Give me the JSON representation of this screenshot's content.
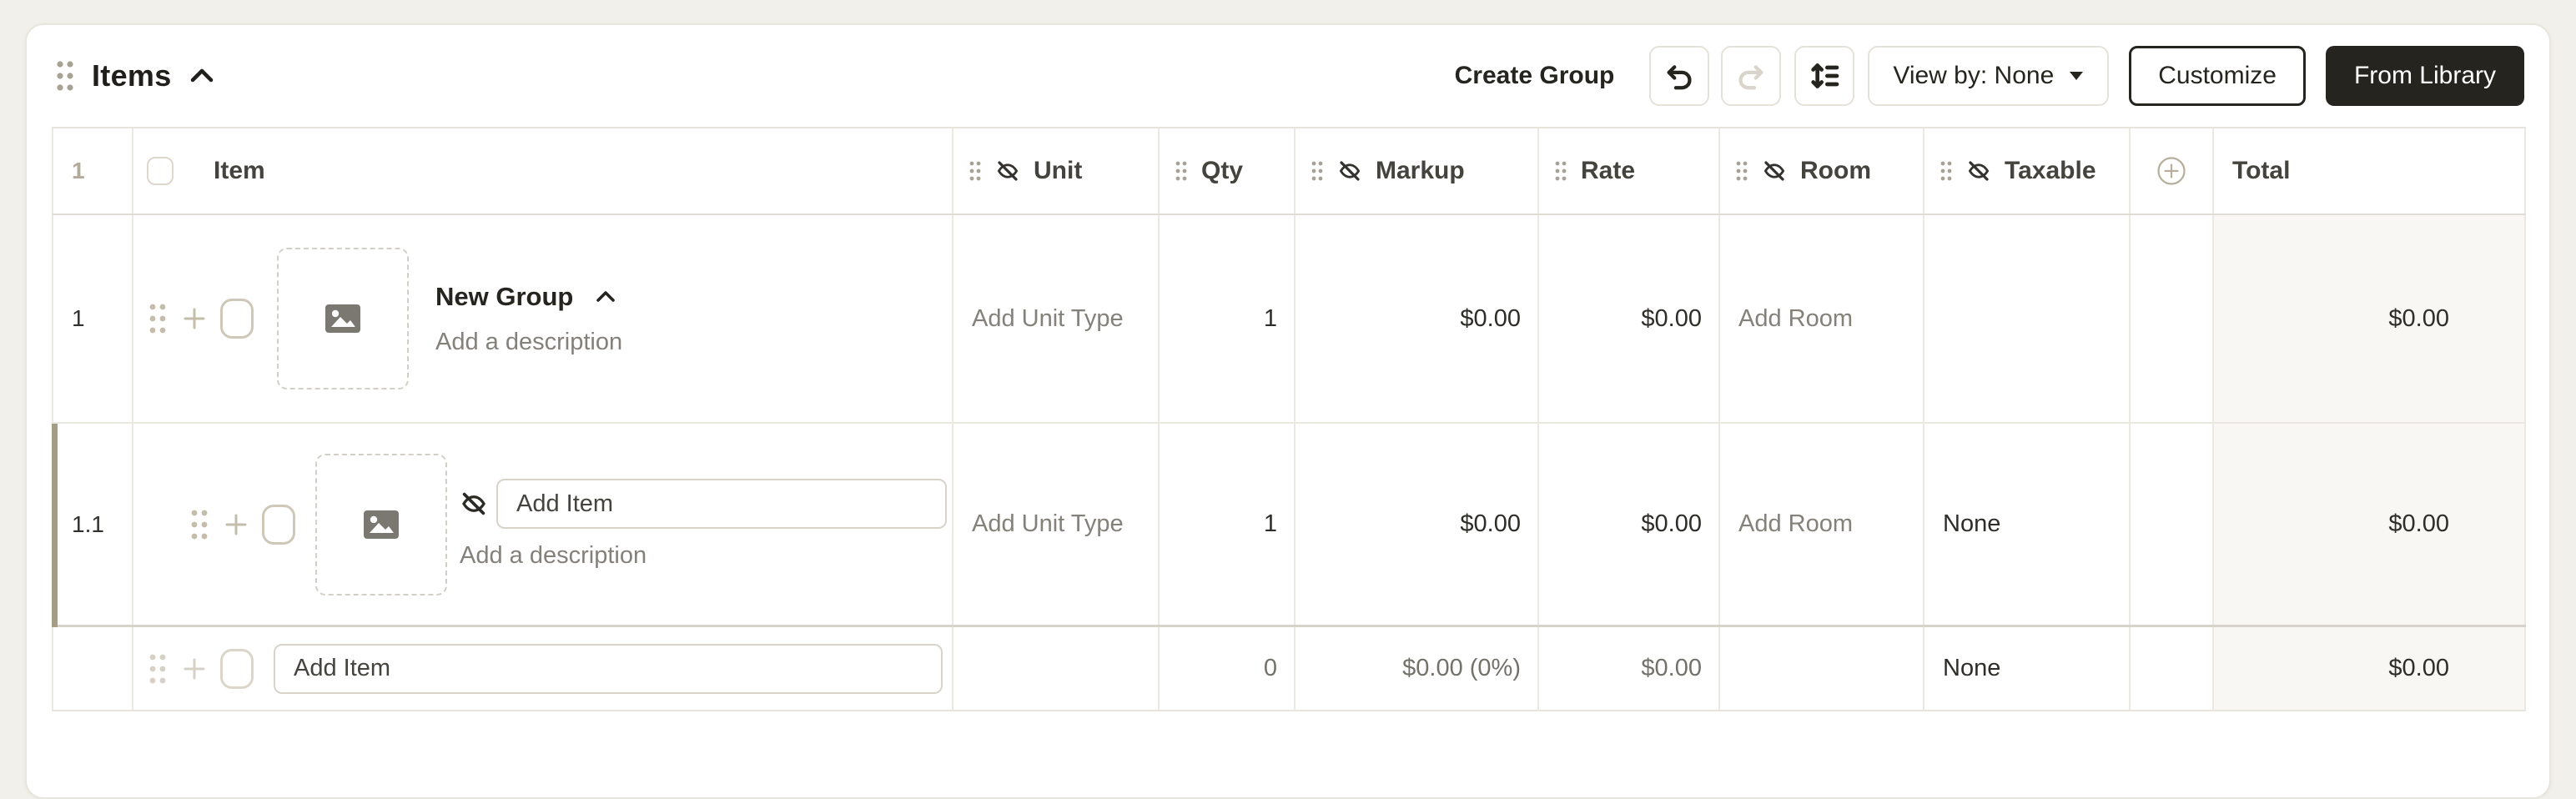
{
  "app": {
    "title": "Items"
  },
  "toolbar": {
    "create_group": "Create Group",
    "view_by": "View by: None",
    "customize": "Customize",
    "from_library": "From Library",
    "icons": {
      "undo": "undo-icon",
      "redo": "redo-icon",
      "row_height": "row-height-icon",
      "caret": "caret-down-icon",
      "collapse": "chevron-up-icon",
      "drag": "drag-handle-icon"
    }
  },
  "columns": {
    "row_number": "1",
    "item": "Item",
    "unit": "Unit",
    "qty": "Qty",
    "markup": "Markup",
    "rate": "Rate",
    "room": "Room",
    "taxable": "Taxable",
    "total": "Total",
    "icons": {
      "hidden": "eye-off-icon",
      "add_column": "plus-circle-icon"
    }
  },
  "rows": {
    "group": {
      "number": "1",
      "name": "New Group",
      "description_placeholder": "Add a description",
      "unit_placeholder": "Add Unit Type",
      "qty": "1",
      "markup": "$0.00",
      "rate": "$0.00",
      "room_placeholder": "Add Room",
      "taxable": "",
      "total": "$0.00"
    },
    "sub_item": {
      "number": "1.1",
      "item_placeholder": "Add Item",
      "description_placeholder": "Add a description",
      "unit_placeholder": "Add Unit Type",
      "qty": "1",
      "markup": "$0.00",
      "rate": "$0.00",
      "room_placeholder": "Add Room",
      "taxable": "None",
      "total": "$0.00"
    },
    "new_item": {
      "item_placeholder": "Add Item",
      "qty": "0",
      "markup": "$0.00 (0%)",
      "rate": "$0.00",
      "taxable": "None",
      "total": "$0.00"
    }
  },
  "colors": {
    "page_bg": "#f1f0ea",
    "card_bg": "#ffffff",
    "grid_border": "#ebe9e2",
    "accent_tan": "#c4bdac",
    "selected_row_bar": "#a69d88",
    "total_column_bg": "#f8f7f3",
    "primary_button_bg": "#26241f",
    "primary_button_text": "#ffffff",
    "placeholder_text": "#84817a",
    "dark_text": "#2f2d29"
  }
}
